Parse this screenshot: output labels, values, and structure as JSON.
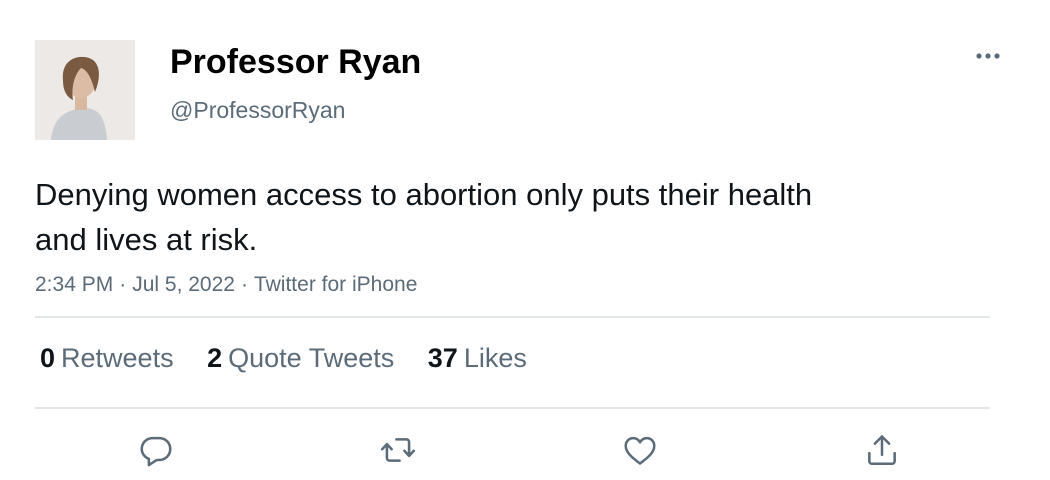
{
  "user": {
    "display_name": "Professor Ryan",
    "handle": "@ProfessorRyan"
  },
  "tweet": {
    "text": "Denying women access to abortion only puts their health and lives at risk.",
    "time": "2:34 PM",
    "date": "Jul 5, 2022",
    "source": "Twitter for iPhone",
    "separator": "·"
  },
  "stats": {
    "retweets_count": "0",
    "retweets_label": "Retweets",
    "quotes_count": "2",
    "quotes_label": "Quote Tweets",
    "likes_count": "37",
    "likes_label": "Likes"
  },
  "icons": {
    "more": "more-horizontal-icon",
    "reply": "reply-icon",
    "retweet": "retweet-icon",
    "like": "heart-icon",
    "share": "share-icon"
  },
  "colors": {
    "text": "#0f1419",
    "secondary_text": "#5b6b78",
    "divider": "#e1e6ea",
    "icon": "#5b6b78"
  }
}
